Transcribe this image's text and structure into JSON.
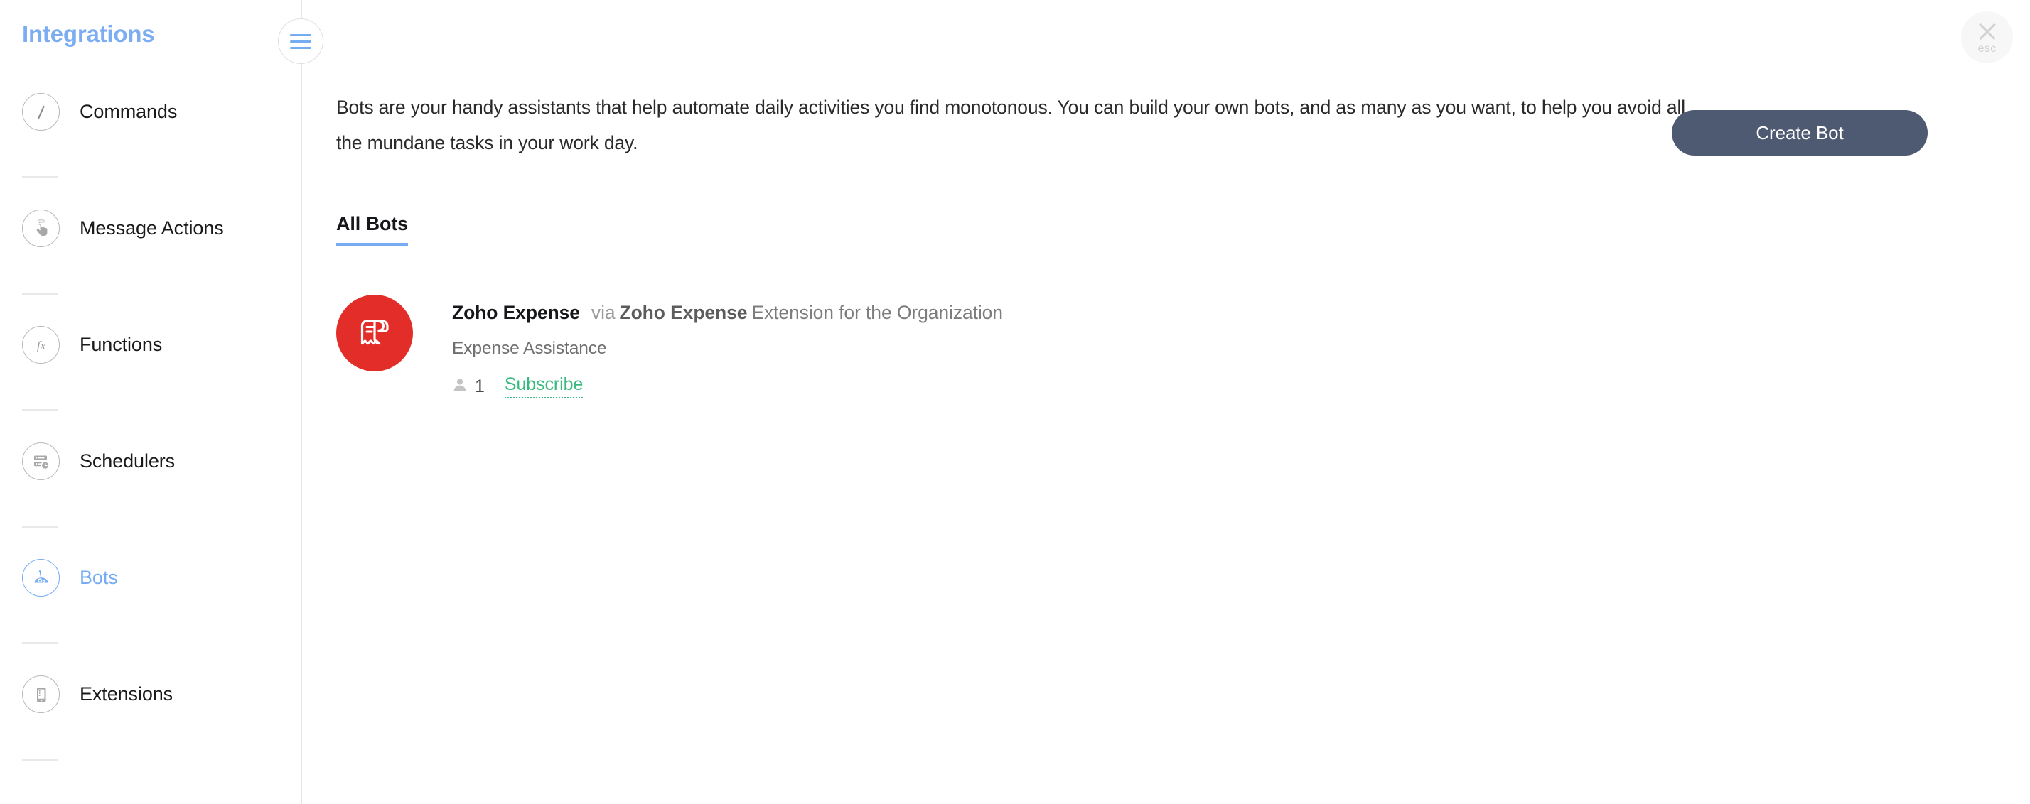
{
  "sidebar": {
    "title": "Integrations",
    "items": [
      {
        "label": "Commands",
        "icon": "slash-command-icon",
        "active": false
      },
      {
        "label": "Message Actions",
        "icon": "tap-hand-icon",
        "active": false
      },
      {
        "label": "Functions",
        "icon": "fx-icon",
        "active": false
      },
      {
        "label": "Schedulers",
        "icon": "scheduler-clock-icon",
        "active": false
      },
      {
        "label": "Bots",
        "icon": "robot-icon",
        "active": true
      },
      {
        "label": "Extensions",
        "icon": "mobile-device-icon",
        "active": false
      }
    ],
    "accent_color": "#76acf2"
  },
  "header": {
    "menu_toggle_icon": "hamburger-icon",
    "close_icon": "close-x-icon",
    "close_label": "esc"
  },
  "main": {
    "intro": "Bots are your handy assistants that help automate daily activities you find monotonous. You can build your own bots, and as many as you want, to help you avoid all the mundane tasks in your work day.",
    "create_button": "Create Bot",
    "create_button_color": "#4e5a72",
    "tabs": [
      {
        "label": "All Bots",
        "active": true
      }
    ],
    "bots": [
      {
        "name": "Zoho Expense",
        "via_label": "via",
        "extension_name": "Zoho Expense",
        "extension_suffix": "Extension for the Organization",
        "description": "Expense Assistance",
        "subscriber_icon": "person-icon",
        "subscriber_count": "1",
        "subscribe_label": "Subscribe",
        "subscribe_color": "#3aba80",
        "logo_icon": "zoho-expense-receipt-icon",
        "logo_color": "#e32d28"
      }
    ]
  }
}
